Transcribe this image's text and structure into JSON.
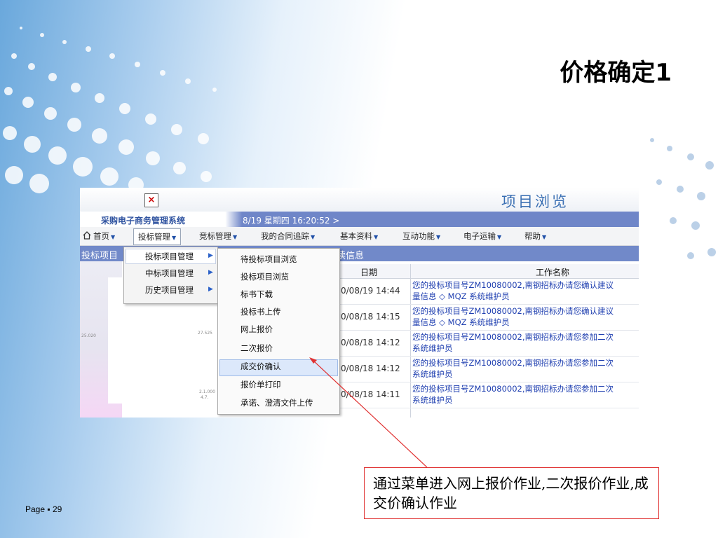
{
  "slide": {
    "title": "价格确定1",
    "page_number": "Page ▪ 29"
  },
  "app": {
    "big_title": "项目浏览",
    "system_name": "采购电子商务管理系统",
    "datetime": "8/19 星期四  16:20:52 >",
    "broken_image_glyph": "×"
  },
  "menubar": {
    "items": [
      "首页",
      "投标管理",
      "竞标管理",
      "我的合同追踪",
      "基本资料",
      "互动功能",
      "电子运输",
      "帮助"
    ],
    "active_index": 1
  },
  "header_band": {
    "left_text": "投标项目",
    "right_text": "读信息"
  },
  "submenu_level1": {
    "items": [
      "投标项目管理",
      "中标项目管理",
      "历史项目管理"
    ],
    "highlighted_index": 0
  },
  "submenu_level2": {
    "items": [
      "待投标项目浏览",
      "投标项目浏览",
      "标书下载",
      "投标书上传",
      "网上报价",
      "二次报价",
      "成交价确认",
      "报价单打印",
      "承诺、澄清文件上传"
    ],
    "highlighted_index": 6
  },
  "table": {
    "headers": [
      "日期",
      "工作名称"
    ],
    "rows": [
      {
        "date": "0/08/19 14:44",
        "line1": "您的投标项目号ZM10080002,南钢招标办请您确认建议",
        "line2": "量信息 ◇ MQZ 系统维护员"
      },
      {
        "date": "0/08/18 14:15",
        "line1": "您的投标项目号ZM10080002,南钢招标办请您确认建议",
        "line2": "量信息 ◇ MQZ 系统维护员"
      },
      {
        "date": "0/08/18 14:12",
        "line1": "您的投标项目号ZM10080002,南钢招标办请您参加二次",
        "line2": "系统维护员"
      },
      {
        "date": "0/08/18 14:12",
        "line1": "您的投标项目号ZM10080002,南钢招标办请您参加二次",
        "line2": "系统维护员"
      },
      {
        "date": "0/08/18 14:11",
        "line1": "您的投标项目号ZM10080002,南钢招标办请您参加二次",
        "line2": "系统维护员"
      }
    ]
  },
  "chart_snippets": {
    "left_label": "25.020",
    "mid_label": "27.525",
    "bottom_label1": "2.1.000",
    "bottom_label2": "4.7."
  },
  "callout": {
    "text": "通过菜单进入网上报价作业,二次报价作业,成交价确认作业"
  },
  "colors": {
    "accent_blue": "#7189c9",
    "link_blue": "#1f3fb0",
    "callout_red": "#e03131"
  }
}
